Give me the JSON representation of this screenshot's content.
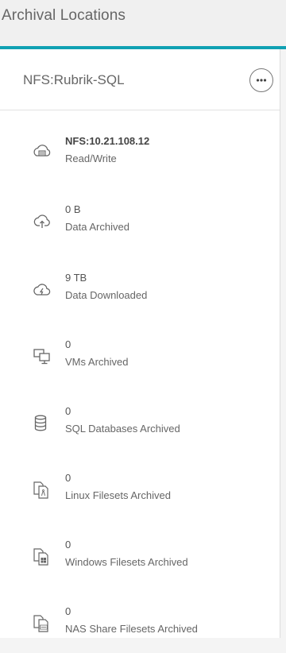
{
  "header": {
    "title": "Archival Locations"
  },
  "location": {
    "name": "NFS:Rubrik-SQL"
  },
  "stats": [
    {
      "value": "NFS:10.21.108.12",
      "label": "Read/Write",
      "icon": "nfs-storage-icon"
    },
    {
      "value": "0 B",
      "label": "Data Archived",
      "icon": "cloud-upload-icon"
    },
    {
      "value": "9 TB",
      "label": "Data Downloaded",
      "icon": "cloud-download-icon"
    },
    {
      "value": "0",
      "label": "VMs Archived",
      "icon": "vm-icon"
    },
    {
      "value": "0",
      "label": "SQL Databases Archived",
      "icon": "database-icon"
    },
    {
      "value": "0",
      "label": "Linux Filesets Archived",
      "icon": "linux-fileset-icon"
    },
    {
      "value": "0",
      "label": "Windows Filesets Archived",
      "icon": "windows-fileset-icon"
    },
    {
      "value": "0",
      "label": "NAS Share Filesets Archived",
      "icon": "nas-fileset-icon"
    }
  ],
  "colors": {
    "accent": "#10a1b3",
    "card_bg": "#ffffff",
    "page_bg": "#f4f4f4"
  }
}
